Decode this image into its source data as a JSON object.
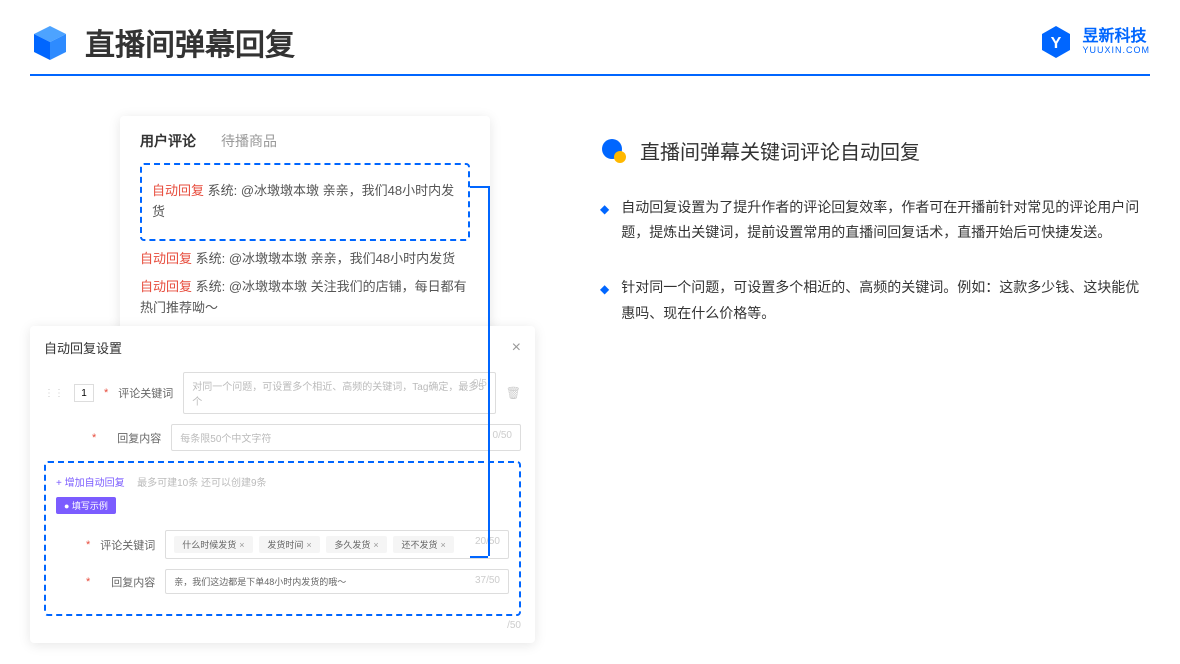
{
  "header": {
    "title": "直播间弹幕回复",
    "logo_cn": "昱新科技",
    "logo_en": "YUUXIN.COM"
  },
  "card1": {
    "tab_active": "用户评论",
    "tab_inactive": "待播商品",
    "comments": [
      {
        "tag": "自动回复",
        "text": "系统: @冰墩墩本墩 亲亲，我们48小时内发货"
      },
      {
        "tag": "自动回复",
        "text": "系统: @冰墩墩本墩 亲亲，我们48小时内发货"
      },
      {
        "tag": "自动回复",
        "text": "系统: @冰墩墩本墩 关注我们的店铺，每日都有热门推荐呦～"
      }
    ]
  },
  "card2": {
    "title": "自动回复设置",
    "row_num": "1",
    "keyword_label": "评论关键词",
    "keyword_placeholder": "对同一个问题，可设置多个相近、高频的关键词，Tag确定，最多5个",
    "keyword_count": "0/5",
    "content_label": "回复内容",
    "content_placeholder": "每条限50个中文字符",
    "content_count": "0/50",
    "add_link": "+ 增加自动回复",
    "add_hint": "最多可建10条 还可以创建9条",
    "example_badge": "● 填写示例",
    "ex_keyword_label": "评论关键词",
    "ex_tags": [
      "什么时候发货",
      "发货时间",
      "多久发货",
      "还不发货"
    ],
    "ex_keyword_count": "20/50",
    "ex_content_label": "回复内容",
    "ex_content_text": "亲，我们这边都是下单48小时内发货的哦～",
    "ex_content_count": "37/50",
    "outer_count": "/50"
  },
  "right": {
    "section_title": "直播间弹幕关键词评论自动回复",
    "bullets": [
      "自动回复设置为了提升作者的评论回复效率，作者可在开播前针对常见的评论用户问题，提炼出关键词，提前设置常用的直播间回复话术，直播开始后可快捷发送。",
      "针对同一个问题，可设置多个相近的、高频的关键词。例如：这款多少钱、这块能优惠吗、现在什么价格等。"
    ]
  }
}
